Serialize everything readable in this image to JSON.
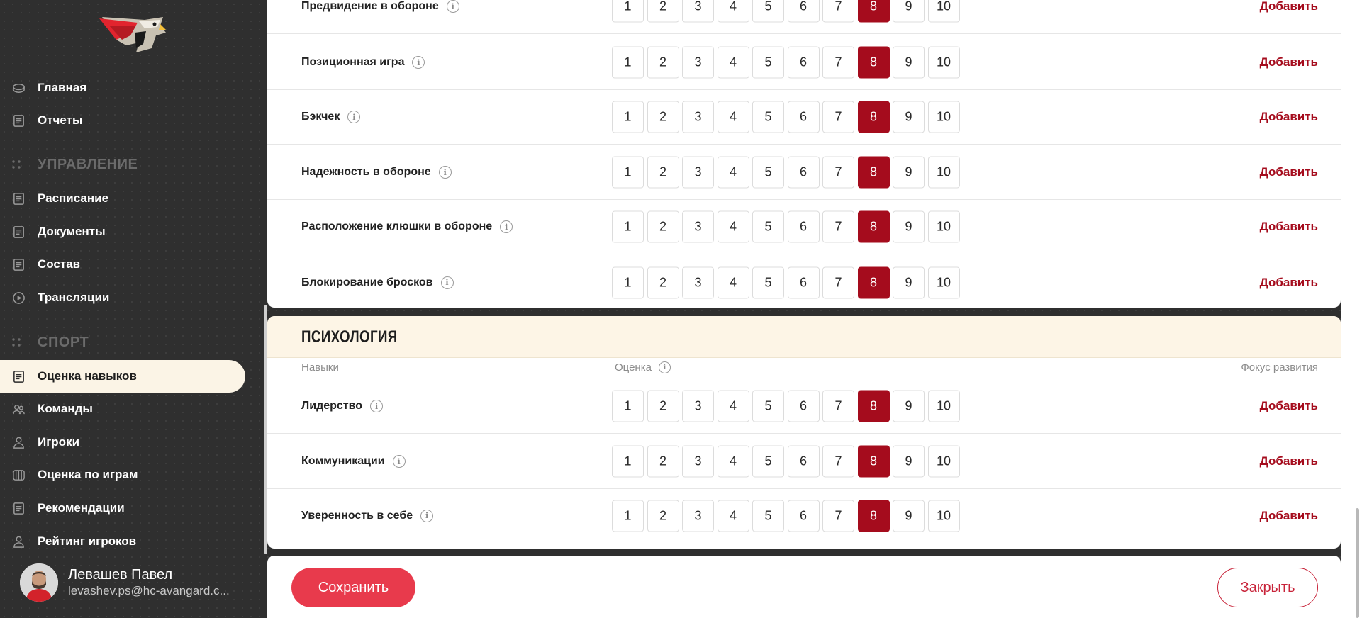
{
  "sidebar": {
    "nav_top": [
      {
        "label": "Главная",
        "icon": "hockey-puck-icon"
      },
      {
        "label": "Отчеты",
        "icon": "document-icon"
      }
    ],
    "sections": [
      {
        "title": "УПРАВЛЕНИЕ",
        "items": [
          {
            "label": "Расписание",
            "icon": "document-icon"
          },
          {
            "label": "Документы",
            "icon": "document-icon"
          },
          {
            "label": "Состав",
            "icon": "document-icon"
          },
          {
            "label": "Трансляции",
            "icon": "play-icon"
          }
        ]
      },
      {
        "title": "СПОРТ",
        "items": [
          {
            "label": "Оценка навыков",
            "icon": "document-icon",
            "active": true
          },
          {
            "label": "Команды",
            "icon": "team-icon"
          },
          {
            "label": "Игроки",
            "icon": "player-icon"
          },
          {
            "label": "Оценка по играм",
            "icon": "rink-icon"
          },
          {
            "label": "Рекомендации",
            "icon": "document-icon"
          },
          {
            "label": "Рейтинг игроков",
            "icon": "player-icon"
          }
        ]
      }
    ],
    "profile": {
      "name": "Левашев Павел",
      "email": "levashev.ps@hc-avangard.c..."
    }
  },
  "scores": [
    "1",
    "2",
    "3",
    "4",
    "5",
    "6",
    "7",
    "8",
    "9",
    "10"
  ],
  "add_label": "Добавить",
  "defense_skills": [
    {
      "name": "Предвидение в обороне",
      "selected": 8
    },
    {
      "name": "Позиционная игра",
      "selected": 8
    },
    {
      "name": "Бэкчек",
      "selected": 8
    },
    {
      "name": "Надежность в обороне",
      "selected": 8
    },
    {
      "name": "Расположение клюшки в обороне",
      "selected": 8
    },
    {
      "name": "Блокирование бросков",
      "selected": 8
    }
  ],
  "psychology": {
    "title": "ПСИХОЛОГИЯ",
    "col_skills": "Навыки",
    "col_score": "Оценка",
    "col_focus": "Фокус развития",
    "skills": [
      {
        "name": "Лидерство",
        "selected": 8
      },
      {
        "name": "Коммуникации",
        "selected": 8
      },
      {
        "name": "Уверенность в себе",
        "selected": 8
      }
    ]
  },
  "footer": {
    "save_label": "Сохранить",
    "close_label": "Закрыть"
  },
  "colors": {
    "accent": "#a50c1d",
    "save_button": "#e83a4c",
    "active_nav_bg": "#fbf4e6",
    "section_header_bg": "#fdf5e6"
  }
}
